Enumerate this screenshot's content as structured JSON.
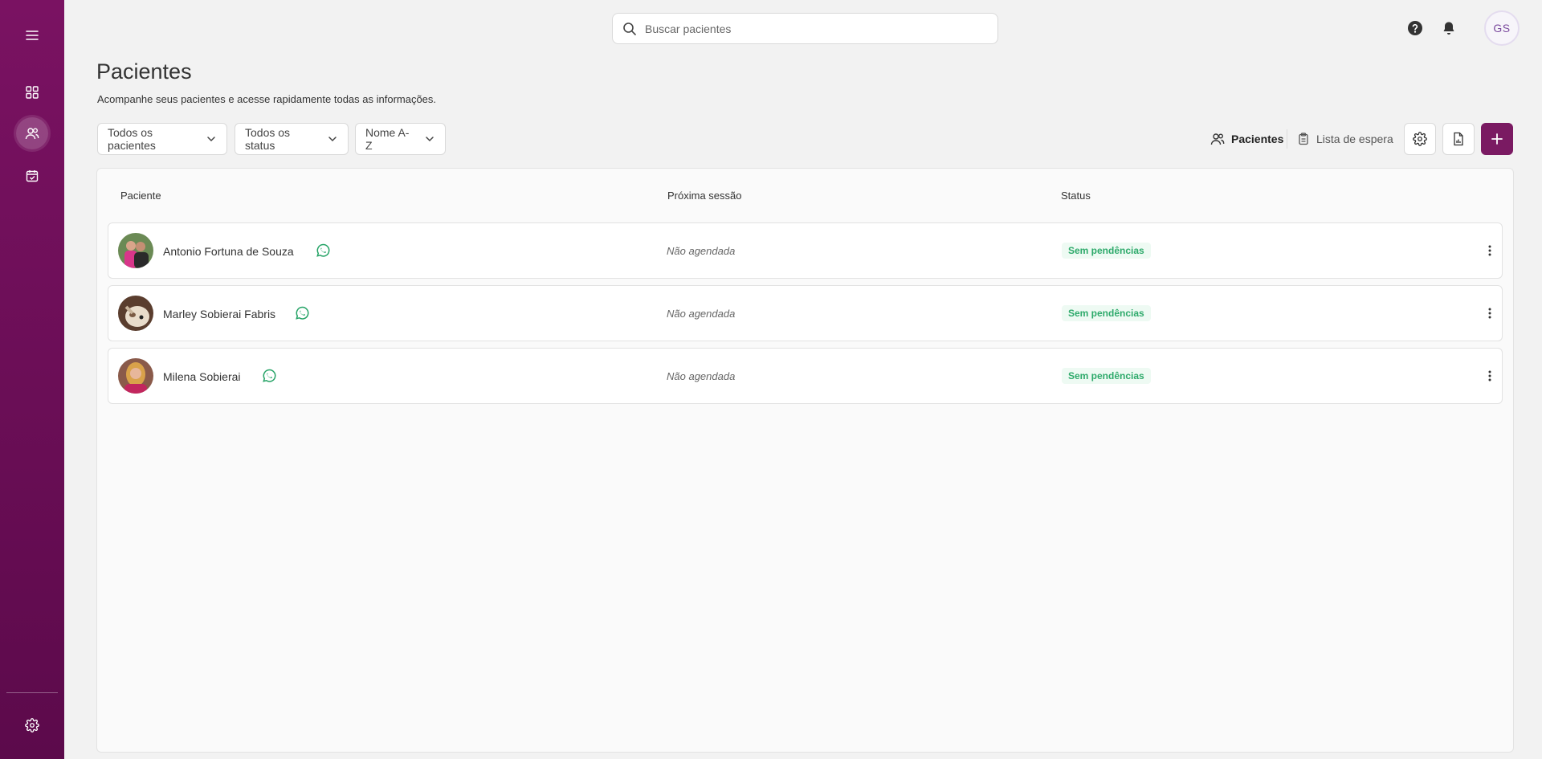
{
  "search": {
    "placeholder": "Buscar pacientes"
  },
  "user": {
    "initials": "GS"
  },
  "page": {
    "title": "Pacientes",
    "subtitle": "Acompanhe seus pacientes e acesse rapidamente todas as informações."
  },
  "filters": {
    "patients": "Todos os pacientes",
    "status": "Todos os status",
    "sort": "Nome A-Z"
  },
  "view_tabs": {
    "patients": "Pacientes",
    "waitlist": "Lista de espera"
  },
  "table": {
    "headers": {
      "patient": "Paciente",
      "next_session": "Próxima sessão",
      "status": "Status"
    },
    "rows": [
      {
        "name": "Antonio Fortuna de Souza",
        "next_session": "Não agendada",
        "status": "Sem pendências"
      },
      {
        "name": "Marley Sobierai Fabris",
        "next_session": "Não agendada",
        "status": "Sem pendências"
      },
      {
        "name": "Milena Sobierai",
        "next_session": "Não agendada",
        "status": "Sem pendências"
      }
    ]
  },
  "colors": {
    "brand": "#7a1a62",
    "status_ok_text": "#2eaa6b",
    "status_ok_bg": "#eefaf3",
    "whatsapp": "#25a366"
  },
  "icons": {
    "sidebar": [
      "menu-icon",
      "dashboard-icon",
      "patients-icon",
      "calendar-icon",
      "settings-icon"
    ],
    "top": [
      "search-icon",
      "help-icon",
      "bell-icon"
    ],
    "toolbar": [
      "settings-icon",
      "report-icon",
      "plus-icon"
    ]
  }
}
